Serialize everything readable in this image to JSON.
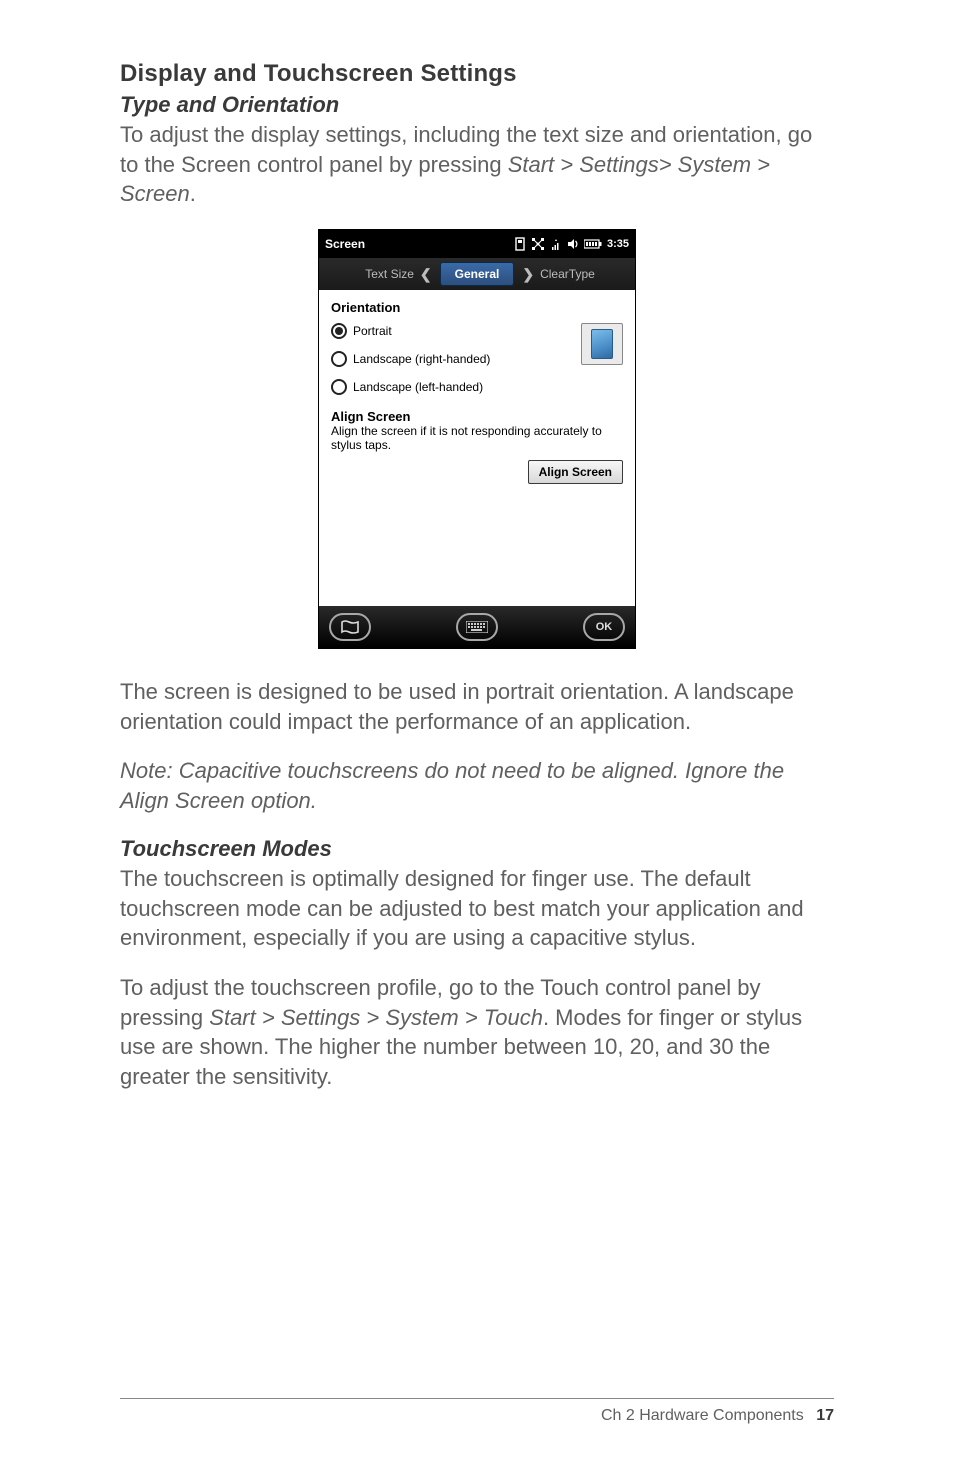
{
  "headings": {
    "h2": "Display and Touchscreen Settings",
    "h3_type": "Type and Orientation",
    "h3_modes": "Touchscreen Modes"
  },
  "paragraphs": {
    "p1a": "To adjust the display settings, including the text size and orientation, go to the Screen control panel by pressing ",
    "p1b": "Start > Settings> System > Screen",
    "p1c": ".",
    "p2": "The screen is designed to be used in portrait orientation. A landscape orientation could impact the performance of an application.",
    "p3": "Note: Capacitive touchscreens do not need to be aligned. Ignore the Align Screen option.",
    "p4": "The touchscreen is optimally designed for finger use. The default touchscreen mode can be adjusted to best match your application and environment, especially if you are using a capacitive stylus.",
    "p5a": "To adjust the touchscreen profile, go to the Touch control panel by pressing ",
    "p5b": "Start > Settings > System > Touch",
    "p5c": ". Modes for finger or stylus use are shown. The higher the number between 10, 20, and 30 the greater the sensitivity."
  },
  "screenshot": {
    "titlebar": {
      "title": "Screen",
      "time": "3:35"
    },
    "tabs": {
      "left": "Text Size",
      "center": "General",
      "right": "ClearType"
    },
    "orientation": {
      "label": "Orientation",
      "options": [
        "Portrait",
        "Landscape (right-handed)",
        "Landscape (left-handed)"
      ],
      "selected": 0
    },
    "align": {
      "title": "Align Screen",
      "desc": "Align the screen if it is not responding accurately to stylus taps.",
      "button": "Align Screen"
    },
    "bottombar": {
      "ok": "OK"
    }
  },
  "footer": {
    "chapter": "Ch 2   Hardware Components",
    "page": "17"
  }
}
